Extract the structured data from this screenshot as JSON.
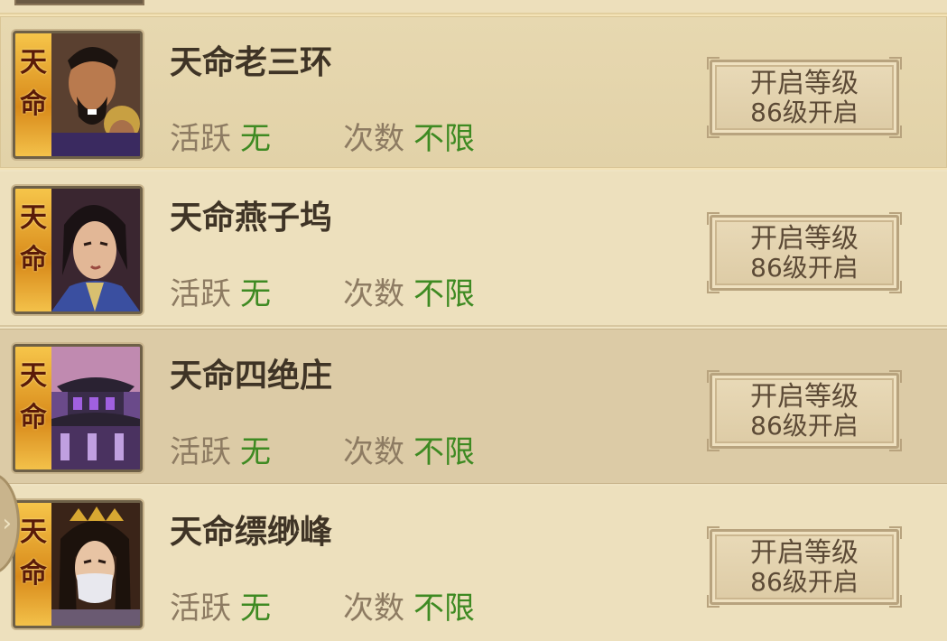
{
  "stages": [
    {
      "title": "天命老三环",
      "badge": "天命",
      "active_label": "活跃",
      "active_value": "无",
      "count_label": "次数",
      "count_value": "不限",
      "button_line1": "开启等级",
      "button_line2": "86级开启",
      "portrait_icon": "warlord-portrait"
    },
    {
      "title": "天命燕子坞",
      "badge": "天命",
      "active_label": "活跃",
      "active_value": "无",
      "count_label": "次数",
      "count_value": "不限",
      "button_line1": "开启等级",
      "button_line2": "86级开启",
      "portrait_icon": "young-swordsman-portrait"
    },
    {
      "title": "天命四绝庄",
      "badge": "天命",
      "active_label": "活跃",
      "active_value": "无",
      "count_label": "次数",
      "count_value": "不限",
      "button_line1": "开启等级",
      "button_line2": "86级开启",
      "portrait_icon": "pavilion-building"
    },
    {
      "title": "天命缥缈峰",
      "badge": "天命",
      "active_label": "活跃",
      "active_value": "无",
      "count_label": "次数",
      "count_value": "不限",
      "button_line1": "开启等级",
      "button_line2": "86级开启",
      "portrait_icon": "veiled-woman-portrait"
    }
  ],
  "colors": {
    "title": "#3f3426",
    "label": "#8d7b62",
    "value_green": "#3e8a22",
    "badge_gold": "#e3a12a"
  },
  "side_tab_icon": "chevron-right-icon"
}
